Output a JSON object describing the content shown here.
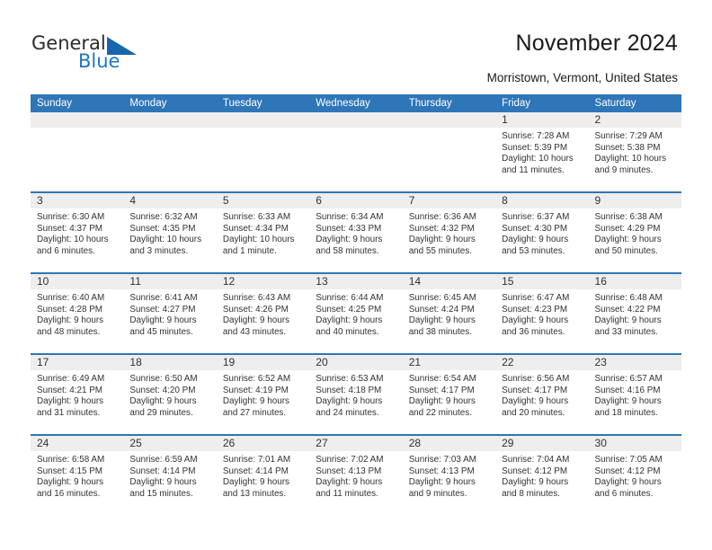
{
  "brand": {
    "name_part1": "General",
    "name_part2": "Blue",
    "triangle_color": "#1566ad",
    "blue_color": "#1f76bd"
  },
  "header": {
    "title": "November 2024",
    "subtitle": "Morristown, Vermont, United States"
  },
  "theme": {
    "header_blue": "#2f76b8",
    "day_band_gray": "#eeeeee",
    "text_color": "#333333"
  },
  "weekdays": [
    "Sunday",
    "Monday",
    "Tuesday",
    "Wednesday",
    "Thursday",
    "Friday",
    "Saturday"
  ],
  "weeks": [
    {
      "days": [
        {
          "number": "",
          "sunrise": "",
          "sunset": "",
          "daylight": "",
          "empty": true
        },
        {
          "number": "",
          "sunrise": "",
          "sunset": "",
          "daylight": "",
          "empty": true
        },
        {
          "number": "",
          "sunrise": "",
          "sunset": "",
          "daylight": "",
          "empty": true
        },
        {
          "number": "",
          "sunrise": "",
          "sunset": "",
          "daylight": "",
          "empty": true
        },
        {
          "number": "",
          "sunrise": "",
          "sunset": "",
          "daylight": "",
          "empty": true
        },
        {
          "number": "1",
          "sunrise": "Sunrise: 7:28 AM",
          "sunset": "Sunset: 5:39 PM",
          "daylight": "Daylight: 10 hours and 11 minutes.",
          "empty": false
        },
        {
          "number": "2",
          "sunrise": "Sunrise: 7:29 AM",
          "sunset": "Sunset: 5:38 PM",
          "daylight": "Daylight: 10 hours and 9 minutes.",
          "empty": false
        }
      ]
    },
    {
      "days": [
        {
          "number": "3",
          "sunrise": "Sunrise: 6:30 AM",
          "sunset": "Sunset: 4:37 PM",
          "daylight": "Daylight: 10 hours and 6 minutes.",
          "empty": false
        },
        {
          "number": "4",
          "sunrise": "Sunrise: 6:32 AM",
          "sunset": "Sunset: 4:35 PM",
          "daylight": "Daylight: 10 hours and 3 minutes.",
          "empty": false
        },
        {
          "number": "5",
          "sunrise": "Sunrise: 6:33 AM",
          "sunset": "Sunset: 4:34 PM",
          "daylight": "Daylight: 10 hours and 1 minute.",
          "empty": false
        },
        {
          "number": "6",
          "sunrise": "Sunrise: 6:34 AM",
          "sunset": "Sunset: 4:33 PM",
          "daylight": "Daylight: 9 hours and 58 minutes.",
          "empty": false
        },
        {
          "number": "7",
          "sunrise": "Sunrise: 6:36 AM",
          "sunset": "Sunset: 4:32 PM",
          "daylight": "Daylight: 9 hours and 55 minutes.",
          "empty": false
        },
        {
          "number": "8",
          "sunrise": "Sunrise: 6:37 AM",
          "sunset": "Sunset: 4:30 PM",
          "daylight": "Daylight: 9 hours and 53 minutes.",
          "empty": false
        },
        {
          "number": "9",
          "sunrise": "Sunrise: 6:38 AM",
          "sunset": "Sunset: 4:29 PM",
          "daylight": "Daylight: 9 hours and 50 minutes.",
          "empty": false
        }
      ]
    },
    {
      "days": [
        {
          "number": "10",
          "sunrise": "Sunrise: 6:40 AM",
          "sunset": "Sunset: 4:28 PM",
          "daylight": "Daylight: 9 hours and 48 minutes.",
          "empty": false
        },
        {
          "number": "11",
          "sunrise": "Sunrise: 6:41 AM",
          "sunset": "Sunset: 4:27 PM",
          "daylight": "Daylight: 9 hours and 45 minutes.",
          "empty": false
        },
        {
          "number": "12",
          "sunrise": "Sunrise: 6:43 AM",
          "sunset": "Sunset: 4:26 PM",
          "daylight": "Daylight: 9 hours and 43 minutes.",
          "empty": false
        },
        {
          "number": "13",
          "sunrise": "Sunrise: 6:44 AM",
          "sunset": "Sunset: 4:25 PM",
          "daylight": "Daylight: 9 hours and 40 minutes.",
          "empty": false
        },
        {
          "number": "14",
          "sunrise": "Sunrise: 6:45 AM",
          "sunset": "Sunset: 4:24 PM",
          "daylight": "Daylight: 9 hours and 38 minutes.",
          "empty": false
        },
        {
          "number": "15",
          "sunrise": "Sunrise: 6:47 AM",
          "sunset": "Sunset: 4:23 PM",
          "daylight": "Daylight: 9 hours and 36 minutes.",
          "empty": false
        },
        {
          "number": "16",
          "sunrise": "Sunrise: 6:48 AM",
          "sunset": "Sunset: 4:22 PM",
          "daylight": "Daylight: 9 hours and 33 minutes.",
          "empty": false
        }
      ]
    },
    {
      "days": [
        {
          "number": "17",
          "sunrise": "Sunrise: 6:49 AM",
          "sunset": "Sunset: 4:21 PM",
          "daylight": "Daylight: 9 hours and 31 minutes.",
          "empty": false
        },
        {
          "number": "18",
          "sunrise": "Sunrise: 6:50 AM",
          "sunset": "Sunset: 4:20 PM",
          "daylight": "Daylight: 9 hours and 29 minutes.",
          "empty": false
        },
        {
          "number": "19",
          "sunrise": "Sunrise: 6:52 AM",
          "sunset": "Sunset: 4:19 PM",
          "daylight": "Daylight: 9 hours and 27 minutes.",
          "empty": false
        },
        {
          "number": "20",
          "sunrise": "Sunrise: 6:53 AM",
          "sunset": "Sunset: 4:18 PM",
          "daylight": "Daylight: 9 hours and 24 minutes.",
          "empty": false
        },
        {
          "number": "21",
          "sunrise": "Sunrise: 6:54 AM",
          "sunset": "Sunset: 4:17 PM",
          "daylight": "Daylight: 9 hours and 22 minutes.",
          "empty": false
        },
        {
          "number": "22",
          "sunrise": "Sunrise: 6:56 AM",
          "sunset": "Sunset: 4:17 PM",
          "daylight": "Daylight: 9 hours and 20 minutes.",
          "empty": false
        },
        {
          "number": "23",
          "sunrise": "Sunrise: 6:57 AM",
          "sunset": "Sunset: 4:16 PM",
          "daylight": "Daylight: 9 hours and 18 minutes.",
          "empty": false
        }
      ]
    },
    {
      "days": [
        {
          "number": "24",
          "sunrise": "Sunrise: 6:58 AM",
          "sunset": "Sunset: 4:15 PM",
          "daylight": "Daylight: 9 hours and 16 minutes.",
          "empty": false
        },
        {
          "number": "25",
          "sunrise": "Sunrise: 6:59 AM",
          "sunset": "Sunset: 4:14 PM",
          "daylight": "Daylight: 9 hours and 15 minutes.",
          "empty": false
        },
        {
          "number": "26",
          "sunrise": "Sunrise: 7:01 AM",
          "sunset": "Sunset: 4:14 PM",
          "daylight": "Daylight: 9 hours and 13 minutes.",
          "empty": false
        },
        {
          "number": "27",
          "sunrise": "Sunrise: 7:02 AM",
          "sunset": "Sunset: 4:13 PM",
          "daylight": "Daylight: 9 hours and 11 minutes.",
          "empty": false
        },
        {
          "number": "28",
          "sunrise": "Sunrise: 7:03 AM",
          "sunset": "Sunset: 4:13 PM",
          "daylight": "Daylight: 9 hours and 9 minutes.",
          "empty": false
        },
        {
          "number": "29",
          "sunrise": "Sunrise: 7:04 AM",
          "sunset": "Sunset: 4:12 PM",
          "daylight": "Daylight: 9 hours and 8 minutes.",
          "empty": false
        },
        {
          "number": "30",
          "sunrise": "Sunrise: 7:05 AM",
          "sunset": "Sunset: 4:12 PM",
          "daylight": "Daylight: 9 hours and 6 minutes.",
          "empty": false
        }
      ]
    }
  ]
}
